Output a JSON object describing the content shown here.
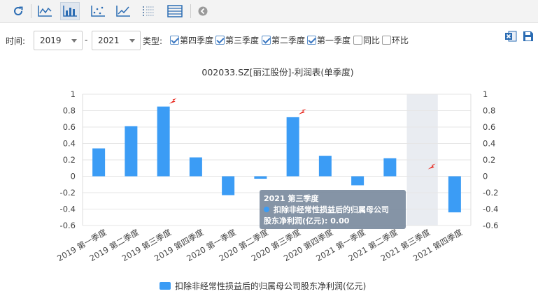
{
  "toolbar": {
    "buttons": [
      {
        "icon": "refresh-icon"
      },
      {
        "icon": "line-chart-icon"
      },
      {
        "icon": "bar-chart-icon",
        "active": true
      },
      {
        "icon": "scatter-chart-icon"
      },
      {
        "icon": "trend-chart-icon"
      },
      {
        "icon": "table-list-icon"
      },
      {
        "icon": "data-list-icon"
      },
      {
        "icon": "collapse-icon"
      }
    ],
    "export_excel_icon": "excel-icon",
    "save_icon": "save-icon"
  },
  "filters": {
    "time_label": "时间:",
    "start_year": "2019",
    "range_dash": "-",
    "end_year": "2021",
    "type_label": "类型:",
    "types": [
      {
        "label": "第四季度",
        "checked": true
      },
      {
        "label": "第三季度",
        "checked": true
      },
      {
        "label": "第二季度",
        "checked": true
      },
      {
        "label": "第一季度",
        "checked": true
      },
      {
        "label": "同比",
        "checked": false
      },
      {
        "label": "环比",
        "checked": false
      }
    ]
  },
  "tooltip": {
    "title": "2021 第三季度",
    "line1": "扣除非经常性损益后的归属母公司",
    "line2": "股东净利润(亿元): 0.00"
  },
  "colors": {
    "bar": "#3b9cf5",
    "grid": "#e6e6e6",
    "highlight": "#e9ecf1",
    "marker": "#e8261c"
  },
  "chart_data": {
    "type": "bar",
    "title": "002033.SZ[丽江股份]-利润表(单季度)",
    "categories": [
      "2019 第一季度",
      "2019 第二季度",
      "2019 第三季度",
      "2019 第四季度",
      "2020 第一季度",
      "2020 第二季度",
      "2020 第三季度",
      "2020 第四季度",
      "2021 第一季度",
      "2021 第二季度",
      "2021 第三季度",
      "2021 第四季度"
    ],
    "series": [
      {
        "name": "扣除非经常性损益后的归属母公司股东净利润(亿元)",
        "values": [
          0.34,
          0.61,
          0.85,
          0.23,
          -0.23,
          -0.03,
          0.72,
          0.25,
          -0.11,
          0.22,
          0.0,
          -0.44
        ]
      }
    ],
    "yticks": [
      "1",
      "0.8",
      "0.6",
      "0.4",
      "0.2",
      "0",
      "-0.2",
      "-0.4",
      "-0.6"
    ],
    "ylim": [
      -0.6,
      1.0
    ],
    "highlighted_category_index": 10,
    "markers_at": [
      2,
      6,
      10
    ],
    "legend": "bottom-center",
    "grid": true
  }
}
